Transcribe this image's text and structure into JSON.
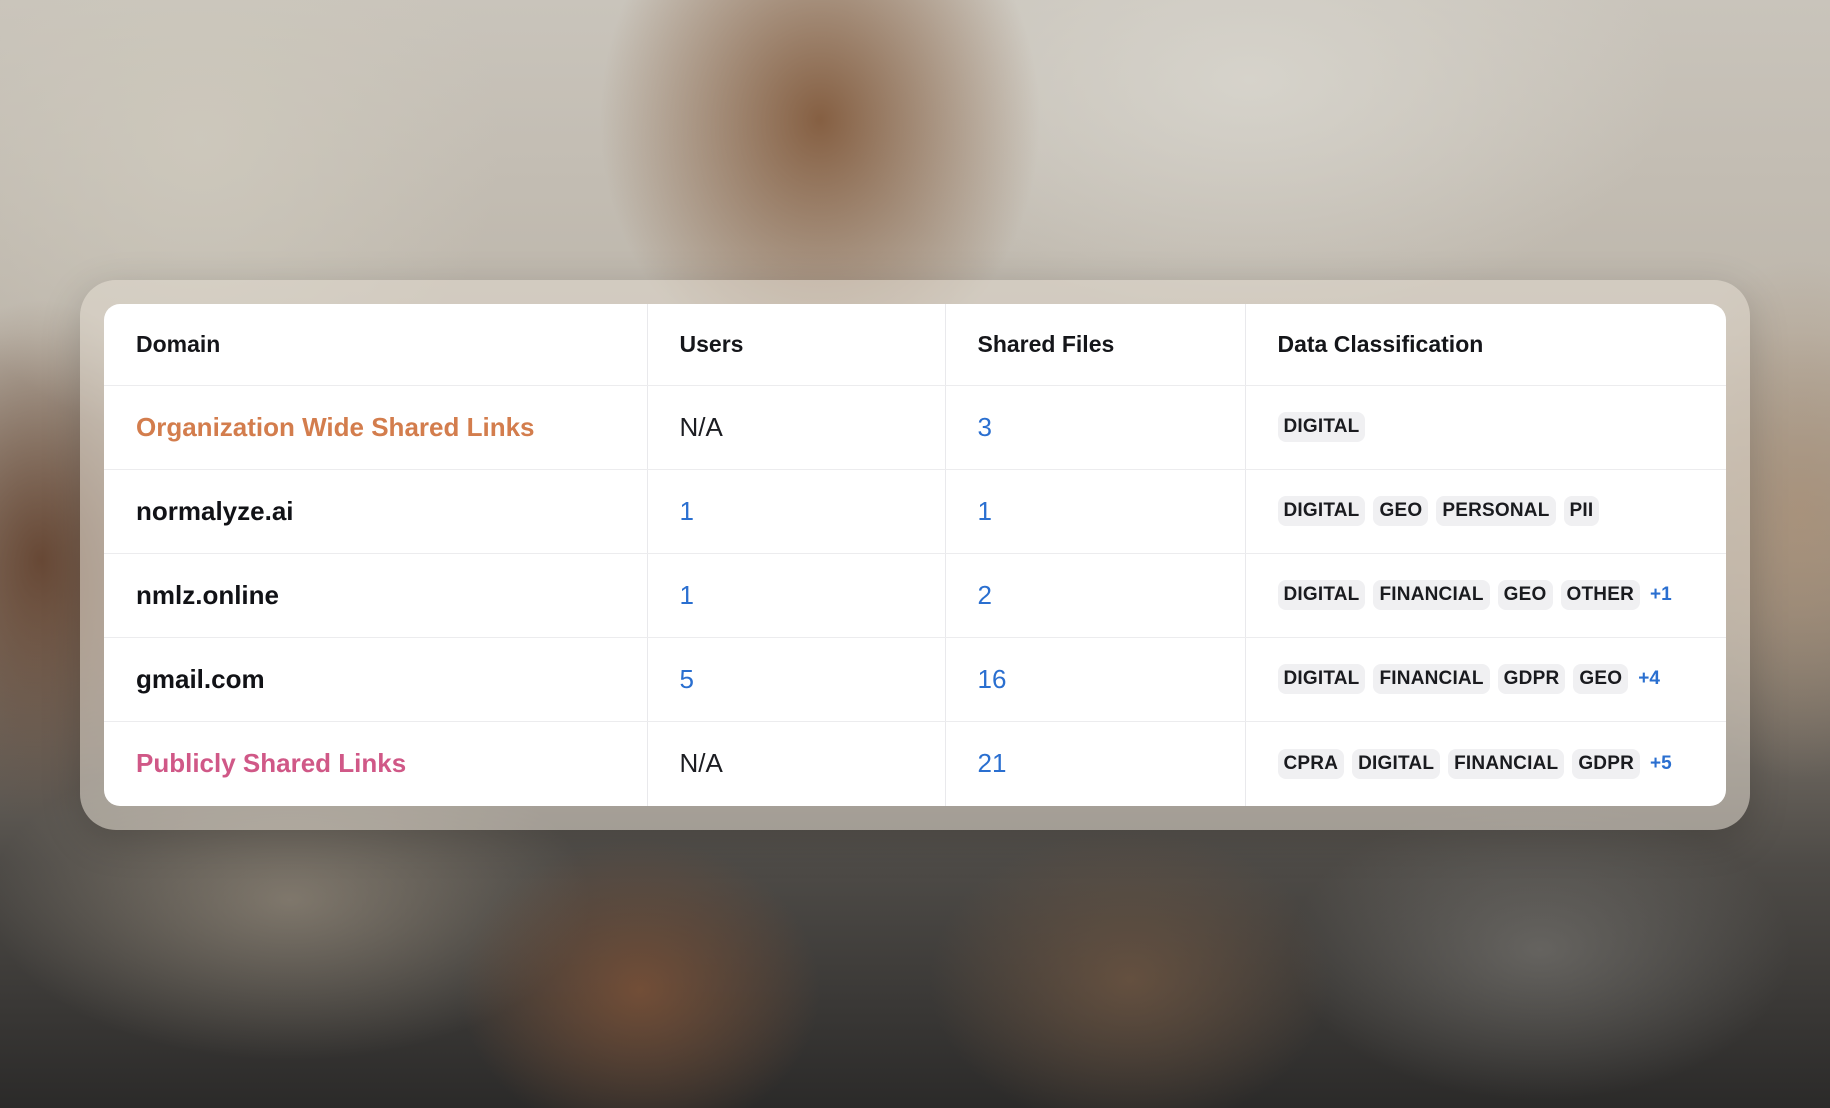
{
  "table": {
    "columns": [
      "Domain",
      "Users",
      "Shared Files",
      "Data Classification"
    ],
    "rows": [
      {
        "domain": "Organization Wide Shared Links",
        "users": "N/A",
        "shared_files": "3",
        "tags": [
          "DIGITAL"
        ],
        "more": ""
      },
      {
        "domain": "normalyze.ai",
        "users": "1",
        "shared_files": "1",
        "tags": [
          "DIGITAL",
          "GEO",
          "PERSONAL",
          "PII"
        ],
        "more": ""
      },
      {
        "domain": "nmlz.online",
        "users": "1",
        "shared_files": "2",
        "tags": [
          "DIGITAL",
          "FINANCIAL",
          "GEO",
          "OTHER"
        ],
        "more": "+1"
      },
      {
        "domain": "gmail.com",
        "users": "5",
        "shared_files": "16",
        "tags": [
          "DIGITAL",
          "FINANCIAL",
          "GDPR",
          "GEO"
        ],
        "more": "+4"
      },
      {
        "domain": "Publicly Shared Links",
        "users": "N/A",
        "shared_files": "21",
        "tags": [
          "CPRA",
          "DIGITAL",
          "FINANCIAL",
          "GDPR"
        ],
        "more": "+5"
      }
    ]
  },
  "colors": {
    "org_link": "#d37d4d",
    "public_link": "#d05887",
    "link_blue": "#2a6fd0",
    "tag_bg": "#f0f0f2"
  }
}
